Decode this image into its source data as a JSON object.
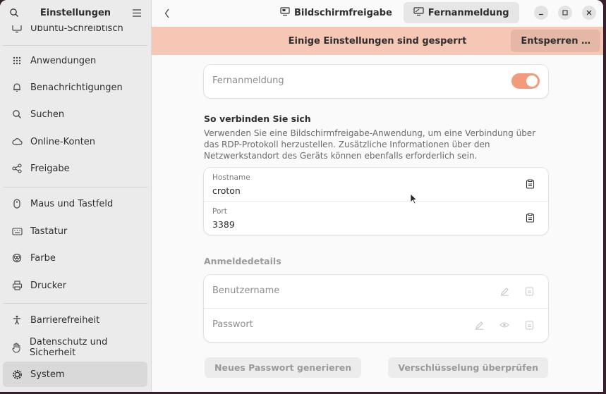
{
  "sidebar": {
    "title": "Einstellungen",
    "partial_top_item": "Ubuntu-Schreibtisch",
    "items": [
      {
        "label": "Anwendungen",
        "icon": "apps-grid-icon"
      },
      {
        "label": "Benachrichtigungen",
        "icon": "bell-icon"
      },
      {
        "label": "Suchen",
        "icon": "search-icon"
      },
      {
        "label": "Online-Konten",
        "icon": "cloud-icon"
      },
      {
        "label": "Freigabe",
        "icon": "share-icon"
      },
      {
        "label": "Maus und Tastfeld",
        "icon": "mouse-icon"
      },
      {
        "label": "Tastatur",
        "icon": "keyboard-icon"
      },
      {
        "label": "Farbe",
        "icon": "color-icon"
      },
      {
        "label": "Drucker",
        "icon": "printer-icon"
      },
      {
        "label": "Barrierefreiheit",
        "icon": "accessibility-icon"
      },
      {
        "label": "Datenschutz und Sicherheit",
        "icon": "hand-icon"
      },
      {
        "label": "System",
        "icon": "gear-icon",
        "selected": true
      }
    ]
  },
  "header": {
    "tabs": [
      {
        "label": "Bildschirmfreigabe",
        "icon": "screen-share-icon",
        "active": false
      },
      {
        "label": "Fernanmeldung",
        "icon": "remote-login-icon",
        "active": true
      }
    ]
  },
  "banner": {
    "text": "Einige Einstellungen sind gesperrt",
    "unlock_label": "Entsperren …"
  },
  "remote_login": {
    "label": "Fernanmeldung",
    "enabled": true
  },
  "connect": {
    "title": "So verbinden Sie sich",
    "description": "Verwenden Sie eine Bildschirmfreigabe-Anwendung, um eine Verbindung über das RDP-Protokoll herzustellen. Zusätzliche Informationen über den Netzwerkstandort des Geräts können ebenfalls erforderlich sein.",
    "hostname_label": "Hostname",
    "hostname_value": "croton",
    "port_label": "Port",
    "port_value": "3389"
  },
  "login_details": {
    "title": "Anmeldedetails",
    "username_placeholder": "Benutzername",
    "password_placeholder": "Passwort",
    "new_password_button": "Neues Passwort generieren",
    "verify_encryption_button": "Verschlüsselung überprüfen"
  },
  "colors": {
    "accent": "#f29a7c",
    "banner": "#f6c7b5"
  }
}
